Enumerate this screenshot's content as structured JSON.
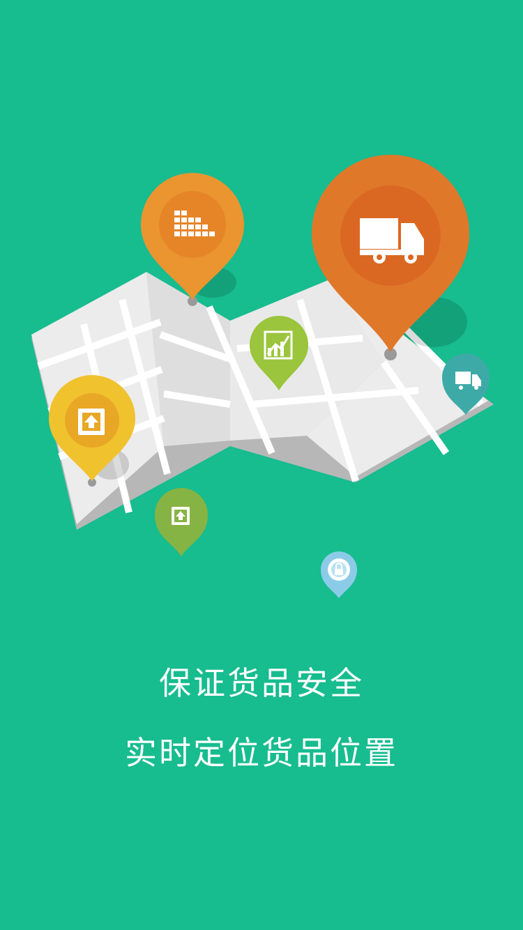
{
  "colors": {
    "background": "#17bc8f",
    "map_light": "#ececec",
    "map_shadow": "#c8c8c8",
    "pin_orange_dark": "#e0782a",
    "pin_orange": "#ea9530",
    "pin_yellow": "#f0c22e",
    "pin_green": "#9ac53c",
    "pin_olive": "#86b444",
    "pin_teal": "#3eaaa7",
    "pin_light_blue": "#8ccbe8"
  },
  "icons": {
    "large_pin": "truck-icon",
    "top_left_pin": "warehouse-icon",
    "middle_pin": "growth-chart-icon",
    "left_pin": "package-upload-icon",
    "bottom_left_pin": "package-upload-icon",
    "right_pin": "truck-icon",
    "bottom_pin": "padlock-icon"
  },
  "captions": {
    "line1": "保证货品安全",
    "line2": "实时定位货品位置"
  }
}
